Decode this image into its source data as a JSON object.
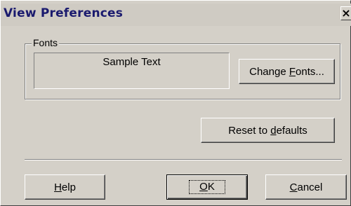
{
  "window": {
    "title": "View Preferences",
    "close_glyph": "×"
  },
  "fonts_group": {
    "label": "Fonts",
    "sample_text": "Sample Text",
    "change_button": {
      "before": "Change ",
      "mnemonic": "F",
      "after": "onts..."
    }
  },
  "reset_button": {
    "before": "Reset to ",
    "mnemonic": "d",
    "after": "efaults"
  },
  "footer": {
    "help_button": {
      "mnemonic": "H",
      "after": "elp"
    },
    "ok_button": {
      "mnemonic": "O",
      "after": "K"
    },
    "cancel_button": {
      "mnemonic": "C",
      "after": "ancel"
    }
  }
}
